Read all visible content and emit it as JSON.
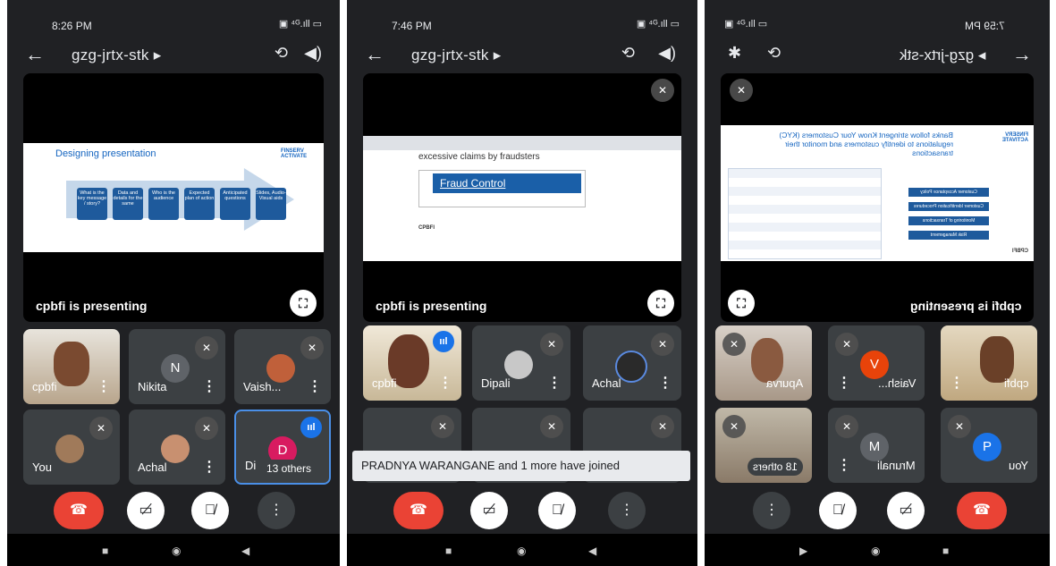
{
  "meeting_code": "gzg-jrtx-stk ▸",
  "icons": {
    "back": "arrow-left-icon",
    "camera_switch": "camera-switch-icon",
    "speaker": "speaker-icon",
    "bluetooth": "bluetooth-icon",
    "mic_off": "mic-off-icon",
    "fullscreen": "fullscreen-icon",
    "more": "more-vertical-icon",
    "end_call": "end-call-icon",
    "camera_off": "camera-off-icon",
    "speaking": "speaking-indicator-icon"
  },
  "colors": {
    "background": "#202124",
    "tile": "#3c4043",
    "end_call": "#ea4335",
    "speaking": "#1a73e8"
  },
  "phones": [
    {
      "time": "8:26 PM",
      "status_icons": "▣ ⁴ᴳ.ıll ▭",
      "presenting": "cpbfi is presenting",
      "slide_title": "Designing presentation",
      "slide_logo": "FINSERV ACTIVATE",
      "slide_steps": [
        "What is the key message / story?",
        "Data and details for the same",
        "Who is the audience",
        "Expected plan of action",
        "Anticipated questions",
        "Slides, Audio-Visual aids"
      ],
      "tiles": [
        {
          "name": "cpbfi",
          "type": "video"
        },
        {
          "name": "Nikita",
          "avatar": "N",
          "avatar_color": "#5f6368"
        },
        {
          "name": "Vaish...",
          "type": "photo"
        },
        {
          "name": "You",
          "type": "photo"
        },
        {
          "name": "Achal",
          "type": "photo"
        },
        {
          "name": "D",
          "avatar": "D",
          "avatar_color": "#d81b60",
          "overlay": "13 others"
        }
      ]
    },
    {
      "time": "7:46 PM",
      "status_icons": "▣ ⁴ᴳ.ıll ▭",
      "presenting": "cpbfi is presenting",
      "slide_header": "excessive claims by fraudsters",
      "slide_button": "Fraud Control",
      "slide_footer": "CPBFI",
      "tiles": [
        {
          "name": "cpbfi",
          "type": "video"
        },
        {
          "name": "Dipali",
          "type": "photo"
        },
        {
          "name": "Achal",
          "type": "photo"
        }
      ],
      "toast": "PRADNYA WARANGANE and 1 more have joined"
    },
    {
      "time": "7:59 PM",
      "status_icons": "▣ ⁴ᴳ.ıll ▭",
      "meeting_code_mirrored": "▸ gzg-jrtx-stk",
      "presenting": "cpbfi is presenting",
      "slide_title": "Banks follow stringent Know Your Customers (KYC) regulations to identify customers and monitor their transactions",
      "slide_logo": "FINSERV ACTIVATE",
      "slide_boxes": [
        "Customer Acceptance Policy",
        "Customer Identification Procedures",
        "Monitoring of Transactions",
        "Risk Management"
      ],
      "slide_footer": "CPBFI",
      "tiles": [
        {
          "name": "Apurva",
          "type": "photo"
        },
        {
          "name": "Vaish...",
          "avatar": "V",
          "avatar_color": "#e8430a"
        },
        {
          "name": "cpbfi",
          "type": "video"
        },
        {
          "name": "18 others",
          "type": "photo"
        },
        {
          "name": "Mrunali",
          "avatar": "M",
          "avatar_color": "#5f6368"
        },
        {
          "name": "You",
          "avatar": "P",
          "avatar_color": "#1a73e8"
        }
      ]
    }
  ]
}
